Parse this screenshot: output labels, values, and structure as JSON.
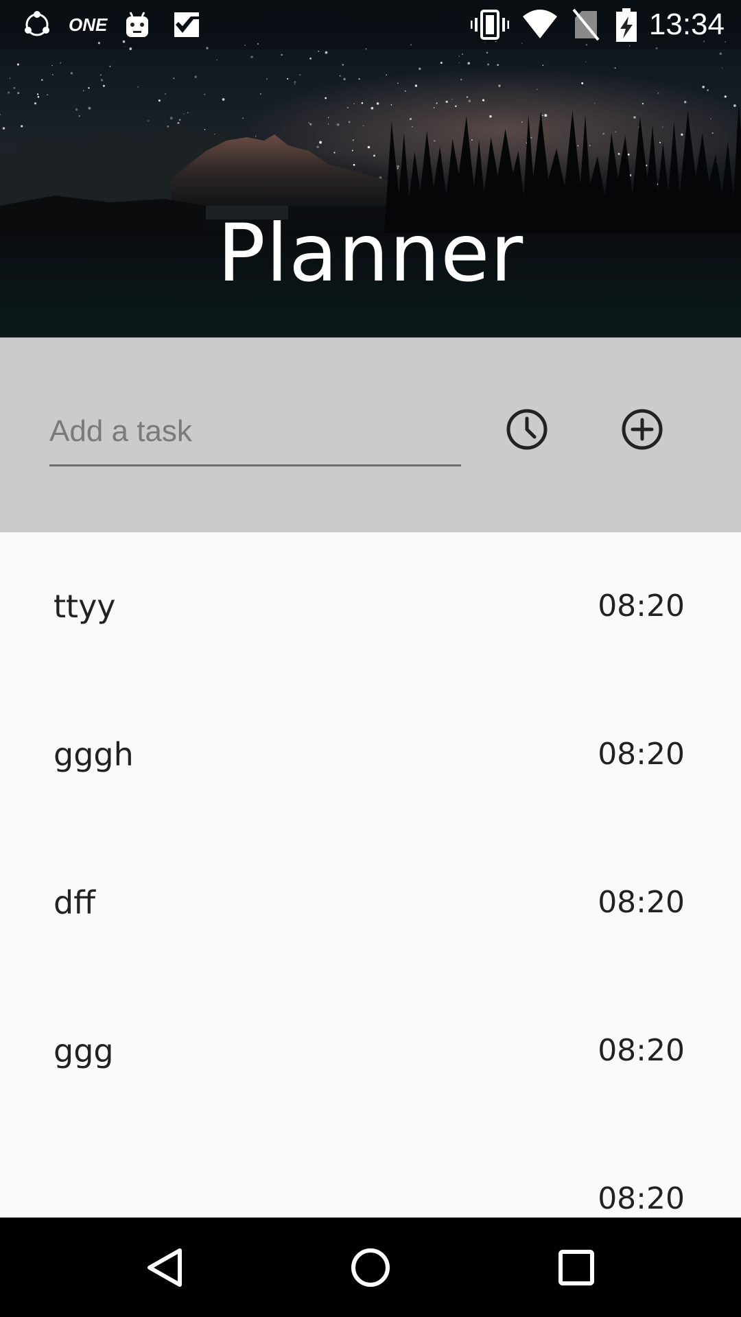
{
  "status_bar": {
    "time": "13:34",
    "left_icons": [
      "shareit-icon",
      "one-icon",
      "android-robot-icon",
      "check-tasks-icon"
    ],
    "one_label": "ONE",
    "right_icons": [
      "vibrate-icon",
      "wifi-icon",
      "no-sim-icon",
      "battery-charging-icon"
    ]
  },
  "header": {
    "title": "Planner"
  },
  "input_panel": {
    "placeholder": "Add a task",
    "value": "",
    "time_icon": "clock-icon",
    "add_icon": "add-circle-icon"
  },
  "tasks": [
    {
      "name": "ttyy",
      "time": "08:20"
    },
    {
      "name": "gggh",
      "time": "08:20"
    },
    {
      "name": "dff",
      "time": "08:20"
    },
    {
      "name": "ggg",
      "time": "08:20"
    },
    {
      "name": "",
      "time": "08:20"
    }
  ],
  "nav_bar": {
    "icons": [
      "back-icon",
      "home-icon",
      "recents-icon"
    ]
  },
  "colors": {
    "panel_background": "#cbcbcb",
    "list_background": "#fafafa",
    "nav_background": "#000000",
    "text_primary": "#222222",
    "title_text": "#ffffff"
  }
}
